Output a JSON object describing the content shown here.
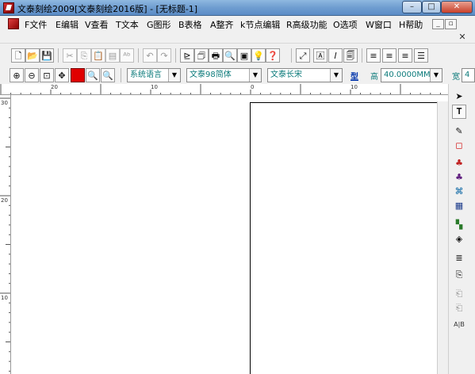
{
  "window": {
    "title": "文泰刻绘2009[文泰刻绘2016版] - [无标题-1]",
    "min_glyph": "–",
    "max_glyph": "□",
    "close_glyph": "✕"
  },
  "menu": {
    "items": [
      "F文件",
      "E编辑",
      "V查看",
      "T文本",
      "G图形",
      "B表格",
      "A整齐",
      "k节点编辑",
      "R高级功能",
      "O选项",
      "W窗口",
      "H帮助"
    ],
    "mdi_min": "_",
    "mdi_restore": "▫",
    "doc_close": "✕"
  },
  "toolbar_main": {
    "new": "🗋",
    "open": "📂",
    "save": "💾",
    "cut": "✂",
    "copy": "⎘",
    "paste": "📋",
    "paste_special": "▤",
    "spell": "ᴬᵇ",
    "undo": "↶",
    "redo": "↷",
    "cut_path": "⊵",
    "write": "🗇",
    "print": "🖶",
    "preview": "🔍",
    "layout": "▣",
    "tip": "💡",
    "help": "❓",
    "node": "⤢",
    "text_box": "🄰",
    "italic": "𝐼",
    "edit_box": "🗐",
    "align_left": "≡",
    "align_center": "≡",
    "align_right": "≡",
    "justify": "☰"
  },
  "toolbar_font": {
    "zoom_in": "⊕",
    "zoom_out": "⊖",
    "zoom_sel": "⊡",
    "move": "✥",
    "color": "#e00000",
    "zoom_a": "🔍",
    "zoom_b": "🔍",
    "language": "系统语言",
    "font_cn": "文泰98简体",
    "font_en": "文泰长宋",
    "style_label": "型",
    "height_label": "高",
    "height_value": "40.0000MM",
    "width_label": "宽",
    "width_value": "4"
  },
  "rulers": {
    "h_labels": [
      "20",
      "10",
      "0",
      "10"
    ],
    "v_labels": [
      "30",
      "20",
      "10"
    ]
  },
  "palette": {
    "select": "➤",
    "text": "𝐓",
    "node_edit": "✎",
    "rect": "◻",
    "tool_a": "♣",
    "tool_b": "♣",
    "tool_c": "⌘",
    "table": "▦",
    "color_grid": "▚",
    "fill": "◈",
    "lines": "≣",
    "stamp": "⎘",
    "dim_a": "⎗",
    "dim_b": "⎗",
    "ab": "A|B"
  }
}
